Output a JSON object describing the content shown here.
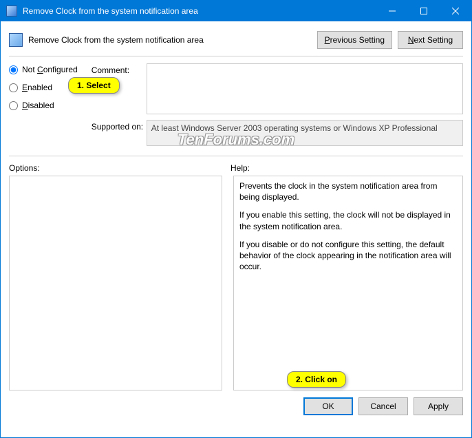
{
  "window": {
    "title": "Remove Clock from the system notification area"
  },
  "header": {
    "setting_name": "Remove Clock from the system notification area",
    "prev_btn": "Previous Setting",
    "prev_underline": "P",
    "next_btn": "Next Setting",
    "next_underline": "N"
  },
  "radios": {
    "not_configured": "Not Configured",
    "not_configured_u": "C",
    "enabled": "Enabled",
    "enabled_u": "E",
    "disabled": "Disabled",
    "disabled_u": "D",
    "selected": "not_configured"
  },
  "labels": {
    "comment": "Comment:",
    "supported": "Supported on:",
    "options": "Options:",
    "help": "Help:"
  },
  "comment": "",
  "supported_on": "At least Windows Server 2003 operating systems or Windows XP Professional",
  "help": {
    "p1": "Prevents the clock in the system notification area from being displayed.",
    "p2": "If you enable this setting, the clock will not be displayed in the system notification area.",
    "p3": "If you disable or do not configure this setting, the default behavior of the clock appearing in the notification area will occur."
  },
  "footer": {
    "ok": "OK",
    "cancel": "Cancel",
    "apply": "Apply"
  },
  "hints": {
    "select": "1. Select",
    "click": "2. Click on"
  },
  "watermark": "TenForums.com"
}
